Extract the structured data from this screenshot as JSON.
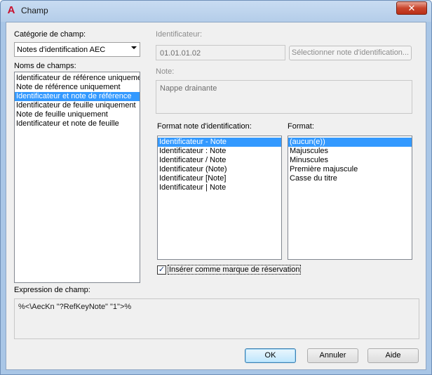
{
  "window": {
    "title": "Champ",
    "close_glyph": "✕",
    "icon": "autocad-a-icon",
    "icon_glyph": "A"
  },
  "left": {
    "category_label": "Catégorie de champ:",
    "category_value": "Notes d'identification AEC",
    "field_names_label": "Noms de champs:",
    "field_names": [
      "Identificateur de référence uniquement",
      "Note de référence uniquement",
      "Identificateur et note de référence",
      "Identificateur de feuille uniquement",
      "Note de feuille uniquement",
      "Identificateur et note de feuille"
    ],
    "selected_index": 2
  },
  "right": {
    "identifier_label": "Identificateur:",
    "identifier_value": "01.01.01.02",
    "select_button": "Sélectionner note d'identification...",
    "note_label": "Note:",
    "note_value": "Nappe drainante",
    "format_note_label": "Format note d'identification:",
    "format_note_options": [
      "Identificateur - Note",
      "Identificateur : Note",
      "Identificateur / Note",
      "Identificateur (Note)",
      "Identificateur [Note]",
      "Identificateur | Note"
    ],
    "format_note_selected": 0,
    "format_label": "Format:",
    "format_options": [
      "(aucun(e))",
      "Majuscules",
      "Minuscules",
      "Première majuscule",
      "Casse du titre"
    ],
    "format_selected": 0,
    "insert_checkbox_label": "Insérer comme marque de réservation",
    "insert_checkbox_checked": true,
    "check_glyph": "✓"
  },
  "expression": {
    "label": "Expression de champ:",
    "value": "%<\\AecKn \"?RefKeyNote\" \"1\">%"
  },
  "buttons": {
    "ok": "OK",
    "cancel": "Annuler",
    "help": "Aide"
  },
  "colors": {
    "selection": "#3399ff",
    "title_bar": "#b9d1ea",
    "close_button": "#c9452d"
  }
}
